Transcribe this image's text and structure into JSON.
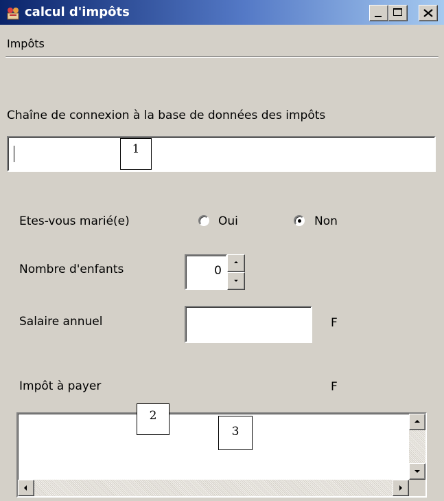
{
  "window": {
    "title": "calcul d'impôts",
    "icon": "app-icon",
    "controls": [
      "minimize-icon",
      "maximize-icon",
      "close-icon"
    ]
  },
  "menu": {
    "items": [
      {
        "label": "Impôts"
      }
    ]
  },
  "form": {
    "connection_label": "Chaîne de connexion à la base de données des impôts",
    "connection_value": "",
    "married_label": "Etes-vous marié(e)",
    "married_options": [
      {
        "label": "Oui",
        "selected": false
      },
      {
        "label": "Non",
        "selected": true
      }
    ],
    "children_label": "Nombre d'enfants",
    "children_value": "0",
    "salary_label": "Salaire annuel",
    "salary_value": "",
    "salary_unit": "F",
    "tax_label": "Impôt à payer",
    "tax_unit": "F"
  },
  "callouts": [
    "1",
    "2",
    "3"
  ]
}
